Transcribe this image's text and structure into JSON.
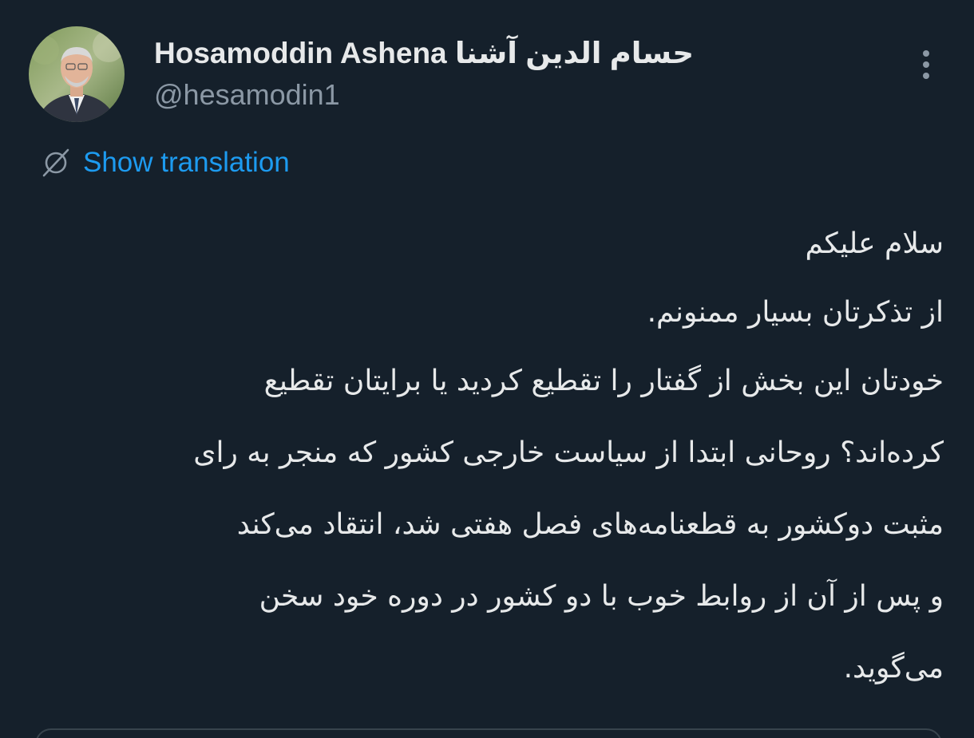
{
  "author": {
    "display_name": "Hosamoddin Ashena حسام الدین آشنا",
    "handle": "@hesamodin1",
    "avatar_icon": "profile-photo"
  },
  "actions": {
    "more_icon": "more-vertical-icon"
  },
  "translate": {
    "icon": "translate-globe-icon",
    "label": "Show translation"
  },
  "tweet": {
    "lines": [
      "سلام علیکم",
      "از تذکرتان بسیار ممنونم.",
      "خودتان این بخش از گفتار را تقطیع کردید یا برایتان تقطیع",
      "کرده‌اند؟ روحانی ابتدا از سیاست خارجی کشور که منجر به رای",
      "مثبت دوکشور به قطعنامه‌های فصل هفتی  شد، انتقاد می‌کند",
      "و پس از آن از روابط خوب با دو کشور در دوره خود سخن",
      "می‌گوید."
    ]
  },
  "colors": {
    "background": "#15202b",
    "text_primary": "#e7e9ea",
    "text_secondary": "#8b98a5",
    "accent": "#1d9bf0"
  }
}
